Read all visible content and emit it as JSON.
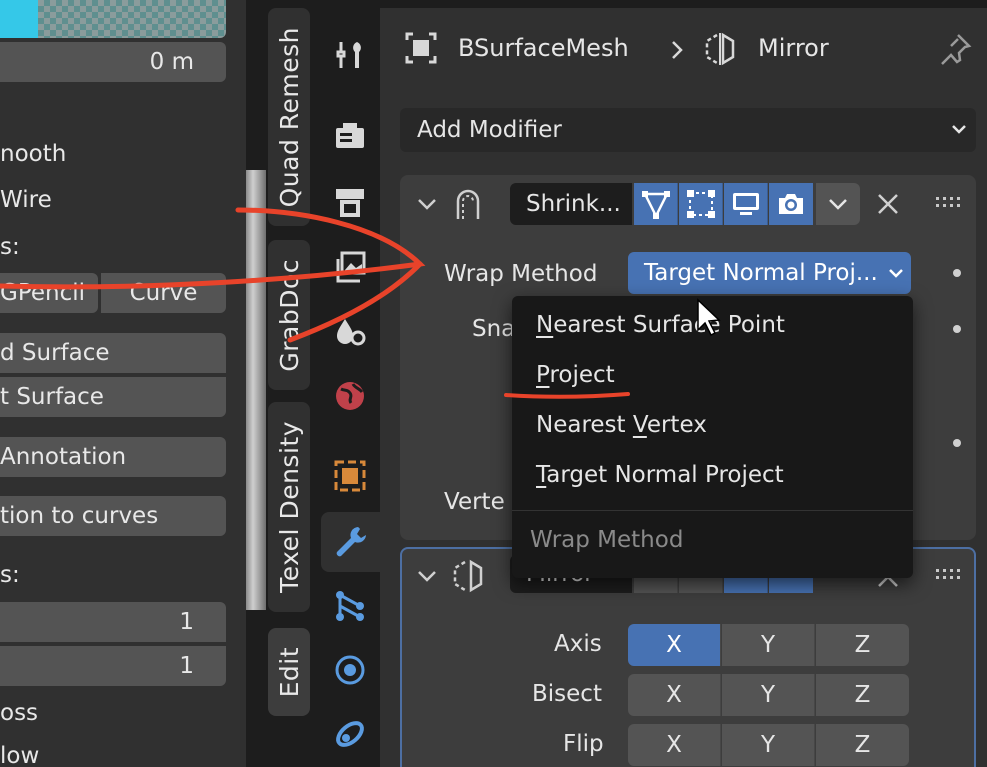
{
  "left_panel": {
    "value_0m": "0 m",
    "smooth": "nooth",
    "wire": "Wire",
    "section1": "s:",
    "gpencil": "GPencil",
    "curve": "Curve",
    "add_surface": "d Surface",
    "edit_surface": "t Surface",
    "annotation": "Annotation",
    "to_curves": "tion to curves",
    "section2": "s:",
    "val1": "1",
    "val2": "1",
    "oss": "oss",
    "low": "low"
  },
  "side_tabs": [
    "Quad Remesh",
    "GrabDoc",
    "Texel Density",
    "Edit"
  ],
  "header": {
    "object_name": "BSurfaceMesh",
    "modifier_name": "Mirror"
  },
  "add_modifier": "Add Modifier",
  "shrinkwrap": {
    "name": "Shrink...",
    "wrap_method_label": "Wrap Method",
    "wrap_method_value": "Target Normal Proj...",
    "snap_label": "Sna",
    "vertex_label": "Verte"
  },
  "menu": {
    "items": [
      {
        "pre": "",
        "ul": "N",
        "post": "earest Surface Point"
      },
      {
        "pre": "",
        "ul": "P",
        "post": "roject"
      },
      {
        "pre": "Nearest ",
        "ul": "V",
        "post": "ertex"
      },
      {
        "pre": "",
        "ul": "T",
        "post": "arget Normal Project"
      }
    ],
    "title": "Wrap Method"
  },
  "mirror": {
    "name": "Mirror",
    "rows": [
      {
        "label": "Axis",
        "x": "X",
        "y": "Y",
        "z": "Z"
      },
      {
        "label": "Bisect",
        "x": "X",
        "y": "Y",
        "z": "Z"
      },
      {
        "label": "Flip",
        "x": "X",
        "y": "Y",
        "z": "Z"
      }
    ]
  },
  "colors": {
    "accent": "#4772b3",
    "panel": "#303030",
    "annotation": "#e8432a",
    "cyan_swatch": "#35c8e8"
  }
}
